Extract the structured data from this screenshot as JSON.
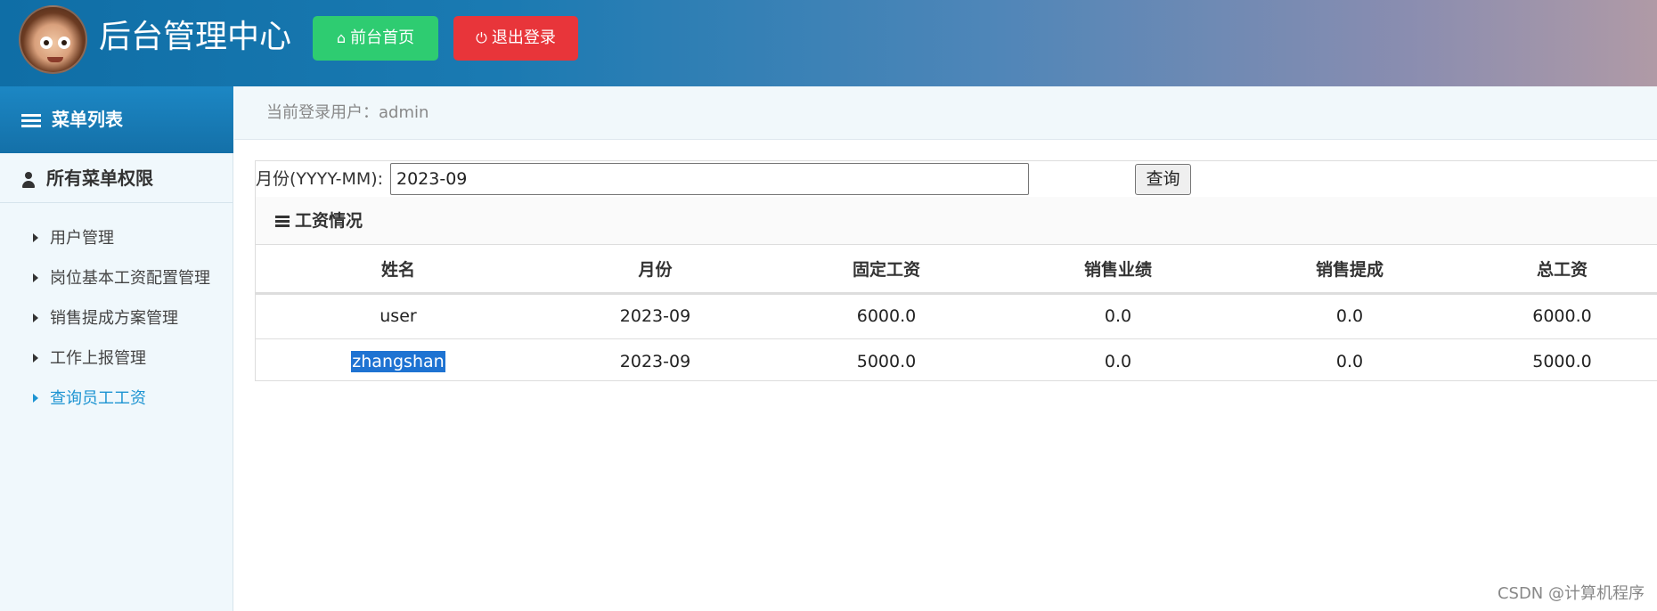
{
  "header": {
    "title": "后台管理中心",
    "home_button": "前台首页",
    "logout_button": "退出登录",
    "home_icon": "home-icon",
    "logout_icon": "power-icon"
  },
  "sidebar": {
    "heading": "菜单列表",
    "group_title": "所有菜单权限",
    "items": [
      {
        "label": "用户管理"
      },
      {
        "label": "岗位基本工资配置管理"
      },
      {
        "label": "销售提成方案管理"
      },
      {
        "label": "工作上报管理"
      },
      {
        "label": "查询员工工资"
      }
    ],
    "active_color": "#1d94d2"
  },
  "breadcrumb": {
    "text": "当前登录用户：admin"
  },
  "search": {
    "label": "月份(YYYY-MM):",
    "value": "2023-09",
    "button": "查询"
  },
  "panel": {
    "heading": "工资情况"
  },
  "table": {
    "columns": [
      "姓名",
      "月份",
      "固定工资",
      "销售业绩",
      "销售提成",
      "总工资"
    ],
    "rows": [
      [
        "user",
        "2023-09",
        "6000.0",
        "0.0",
        "0.0",
        "6000.0"
      ],
      [
        "zhangshan",
        "2023-09",
        "5000.0",
        "0.0",
        "0.0",
        "5000.0"
      ]
    ]
  },
  "watermark": "CSDN @计算机程序",
  "colors": {
    "home_button": "#2ecc71",
    "logout_button": "#e8353a",
    "sidebar_header": "#1c87c4"
  }
}
